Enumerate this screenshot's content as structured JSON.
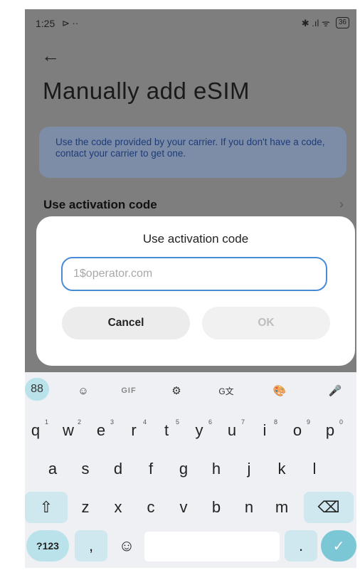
{
  "status_bar": {
    "time": "1:25",
    "left_icons": "⊳ ··",
    "right_icons": "✱ .ıl ᯤ",
    "battery": "36"
  },
  "page": {
    "title": "Manually add eSIM",
    "info_text": "Use the code provided by your carrier. If you don't have a code, contact your carrier to get one.",
    "list_item_label": "Use activation code",
    "list_chevron": "›"
  },
  "dialog": {
    "title": "Use activation code",
    "input_placeholder": "1$operator.com",
    "input_value": "",
    "cancel_label": "Cancel",
    "ok_label": "OK"
  },
  "keyboard": {
    "toolbar": {
      "apps": "88",
      "emoji": "☺",
      "gif": "GIF",
      "settings": "⚙",
      "translate": "G文",
      "theme": "🎨",
      "mic": "🎤"
    },
    "row1": [
      {
        "k": "q",
        "n": "1"
      },
      {
        "k": "w",
        "n": "2"
      },
      {
        "k": "e",
        "n": "3"
      },
      {
        "k": "r",
        "n": "4"
      },
      {
        "k": "t",
        "n": "5"
      },
      {
        "k": "y",
        "n": "6"
      },
      {
        "k": "u",
        "n": "7"
      },
      {
        "k": "i",
        "n": "8"
      },
      {
        "k": "o",
        "n": "9"
      },
      {
        "k": "p",
        "n": "0"
      }
    ],
    "row2": [
      "a",
      "s",
      "d",
      "f",
      "g",
      "h",
      "j",
      "k",
      "l"
    ],
    "row3": [
      "z",
      "x",
      "c",
      "v",
      "b",
      "n",
      "m"
    ],
    "shift": "⇧",
    "backspace": "⌫",
    "num_key": "?123",
    "comma": ",",
    "emoji_key": "☺",
    "period": ".",
    "done": "✓"
  }
}
